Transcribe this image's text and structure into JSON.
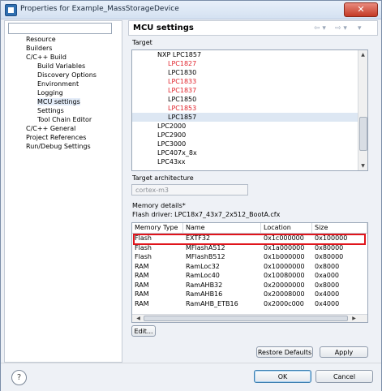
{
  "window": {
    "title": "Properties for Example_MassStorageDevice",
    "close_glyph": "✕"
  },
  "nav": {
    "filter_placeholder": "",
    "items": [
      {
        "label": "Resource",
        "level": 0
      },
      {
        "label": "Builders",
        "level": 0
      },
      {
        "label": "C/C++ Build",
        "level": 0
      },
      {
        "label": "Build Variables",
        "level": 1
      },
      {
        "label": "Discovery Options",
        "level": 1
      },
      {
        "label": "Environment",
        "level": 1
      },
      {
        "label": "Logging",
        "level": 1
      },
      {
        "label": "MCU settings",
        "level": 1,
        "selected": true
      },
      {
        "label": "Settings",
        "level": 1
      },
      {
        "label": "Tool Chain Editor",
        "level": 1
      },
      {
        "label": "C/C++ General",
        "level": 0
      },
      {
        "label": "Project References",
        "level": 0
      },
      {
        "label": "Run/Debug Settings",
        "level": 0
      }
    ]
  },
  "page": {
    "title": "MCU settings",
    "history_back": "⇦ ▾",
    "history_fwd": "⇨ ▾",
    "menu_glyph": "▾"
  },
  "target": {
    "label": "Target",
    "items": [
      {
        "label": "NXP LPC1857",
        "indent": 1,
        "red": false
      },
      {
        "label": "LPC1827",
        "indent": 2,
        "red": true
      },
      {
        "label": "LPC1830",
        "indent": 2,
        "red": false
      },
      {
        "label": "LPC1833",
        "indent": 2,
        "red": true
      },
      {
        "label": "LPC1837",
        "indent": 2,
        "red": true
      },
      {
        "label": "LPC1850",
        "indent": 2,
        "red": false
      },
      {
        "label": "LPC1853",
        "indent": 2,
        "red": true
      },
      {
        "label": "LPC1857",
        "indent": 2,
        "red": false,
        "highlighted": true
      },
      {
        "label": "LPC2000",
        "indent": 1,
        "red": false
      },
      {
        "label": "LPC2900",
        "indent": 1,
        "red": false
      },
      {
        "label": "LPC3000",
        "indent": 1,
        "red": false
      },
      {
        "label": "LPC407x_8x",
        "indent": 1,
        "red": false
      },
      {
        "label": "LPC43xx",
        "indent": 1,
        "red": false
      }
    ]
  },
  "architecture": {
    "label": "Target architecture",
    "value": "cortex-m3"
  },
  "memory": {
    "label": "Memory details*",
    "flash_driver": "Flash driver: LPC18x7_43x7_2x512_BootA.cfx",
    "columns": [
      "Memory Type",
      "Name",
      "Location",
      "Size"
    ],
    "rows": [
      [
        "Flash",
        "EXTF32",
        "0x1c000000",
        "0x100000"
      ],
      [
        "Flash",
        "MFlashA512",
        "0x1a000000",
        "0x80000"
      ],
      [
        "Flash",
        "MFlashB512",
        "0x1b000000",
        "0x80000"
      ],
      [
        "RAM",
        "RamLoc32",
        "0x10000000",
        "0x8000"
      ],
      [
        "RAM",
        "RamLoc40",
        "0x10080000",
        "0xa000"
      ],
      [
        "RAM",
        "RamAHB32",
        "0x20000000",
        "0x8000"
      ],
      [
        "RAM",
        "RamAHB16",
        "0x20008000",
        "0x4000"
      ],
      [
        "RAM",
        "RamAHB_ETB16",
        "0x2000c000",
        "0x4000"
      ]
    ],
    "edit_button": "Edit..."
  },
  "buttons": {
    "restore_defaults": "Restore Defaults",
    "apply": "Apply",
    "ok": "OK",
    "cancel": "Cancel",
    "help": "?"
  }
}
